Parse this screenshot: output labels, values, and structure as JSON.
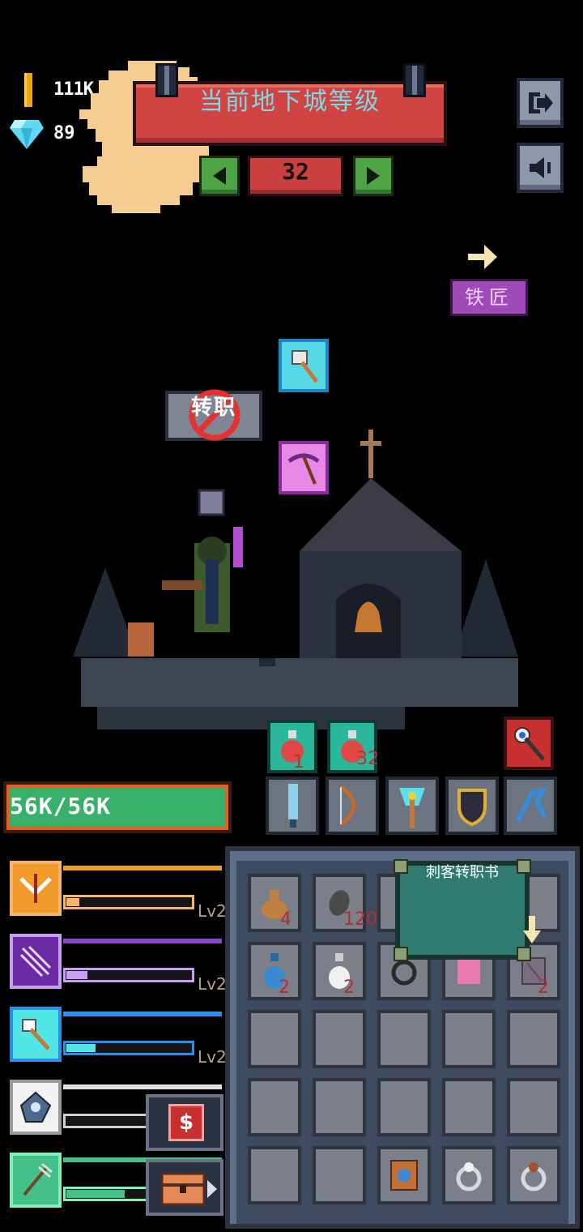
{
  "hud": {
    "gold": "111K",
    "gems": "89"
  },
  "banner": {
    "title": "当前地下城等级"
  },
  "level": {
    "value": "32"
  },
  "side_buttons": {
    "exit_icon": "exit-icon",
    "sound_icon": "sound-icon"
  },
  "npc": {
    "smith_label": "铁匠"
  },
  "job_button": {
    "label": "转职"
  },
  "potions": [
    {
      "color": "red",
      "count": "1"
    },
    {
      "color": "red",
      "count": "32"
    }
  ],
  "hp": {
    "text": "56K/56K",
    "fraction": 1.0
  },
  "skills": [
    {
      "color": "#f39a2c",
      "accent": "#f5b56a",
      "label": "Lv2",
      "progress": 0.1
    },
    {
      "color": "#8a49c4",
      "accent": "#c79ff0",
      "label": "Lv2",
      "progress": 0.2
    },
    {
      "color": "#2a8fe8",
      "accent": "#53e6e6",
      "label": "Lv2",
      "progress": 0.2
    },
    {
      "color": "#d9d9d9",
      "accent": "#ffffff",
      "label": "",
      "progress": 0.0
    },
    {
      "color": "#46c08a",
      "accent": "#7ff0b6",
      "label": "",
      "progress": 0.7
    }
  ],
  "inventory": {
    "tooltip": "刺客转职书",
    "row1": [
      {
        "item": "sack",
        "count": "4"
      },
      {
        "item": "stone",
        "count": "120"
      },
      {
        "item": "coin",
        "count": ""
      },
      {
        "item": "",
        "count": ""
      },
      {
        "item": "",
        "count": ""
      }
    ],
    "row2": [
      {
        "item": "blue-potion",
        "count": "2"
      },
      {
        "item": "white-potion",
        "count": "2"
      },
      {
        "item": "ring",
        "count": ""
      },
      {
        "item": "pink-book",
        "count": ""
      },
      {
        "item": "job-book",
        "count": "2"
      }
    ],
    "row5": [
      {
        "item": "",
        "count": ""
      },
      {
        "item": "",
        "count": ""
      },
      {
        "item": "spell-book",
        "count": ""
      },
      {
        "item": "silver-ring",
        "count": ""
      },
      {
        "item": "ruby-ring",
        "count": ""
      }
    ]
  },
  "colors": {
    "banner": "#d04542",
    "banner_text": "#7fd6e6",
    "hp_fill": "#38b06a",
    "smith": "#a04ab9",
    "potion_bg": "#2bb79c"
  }
}
